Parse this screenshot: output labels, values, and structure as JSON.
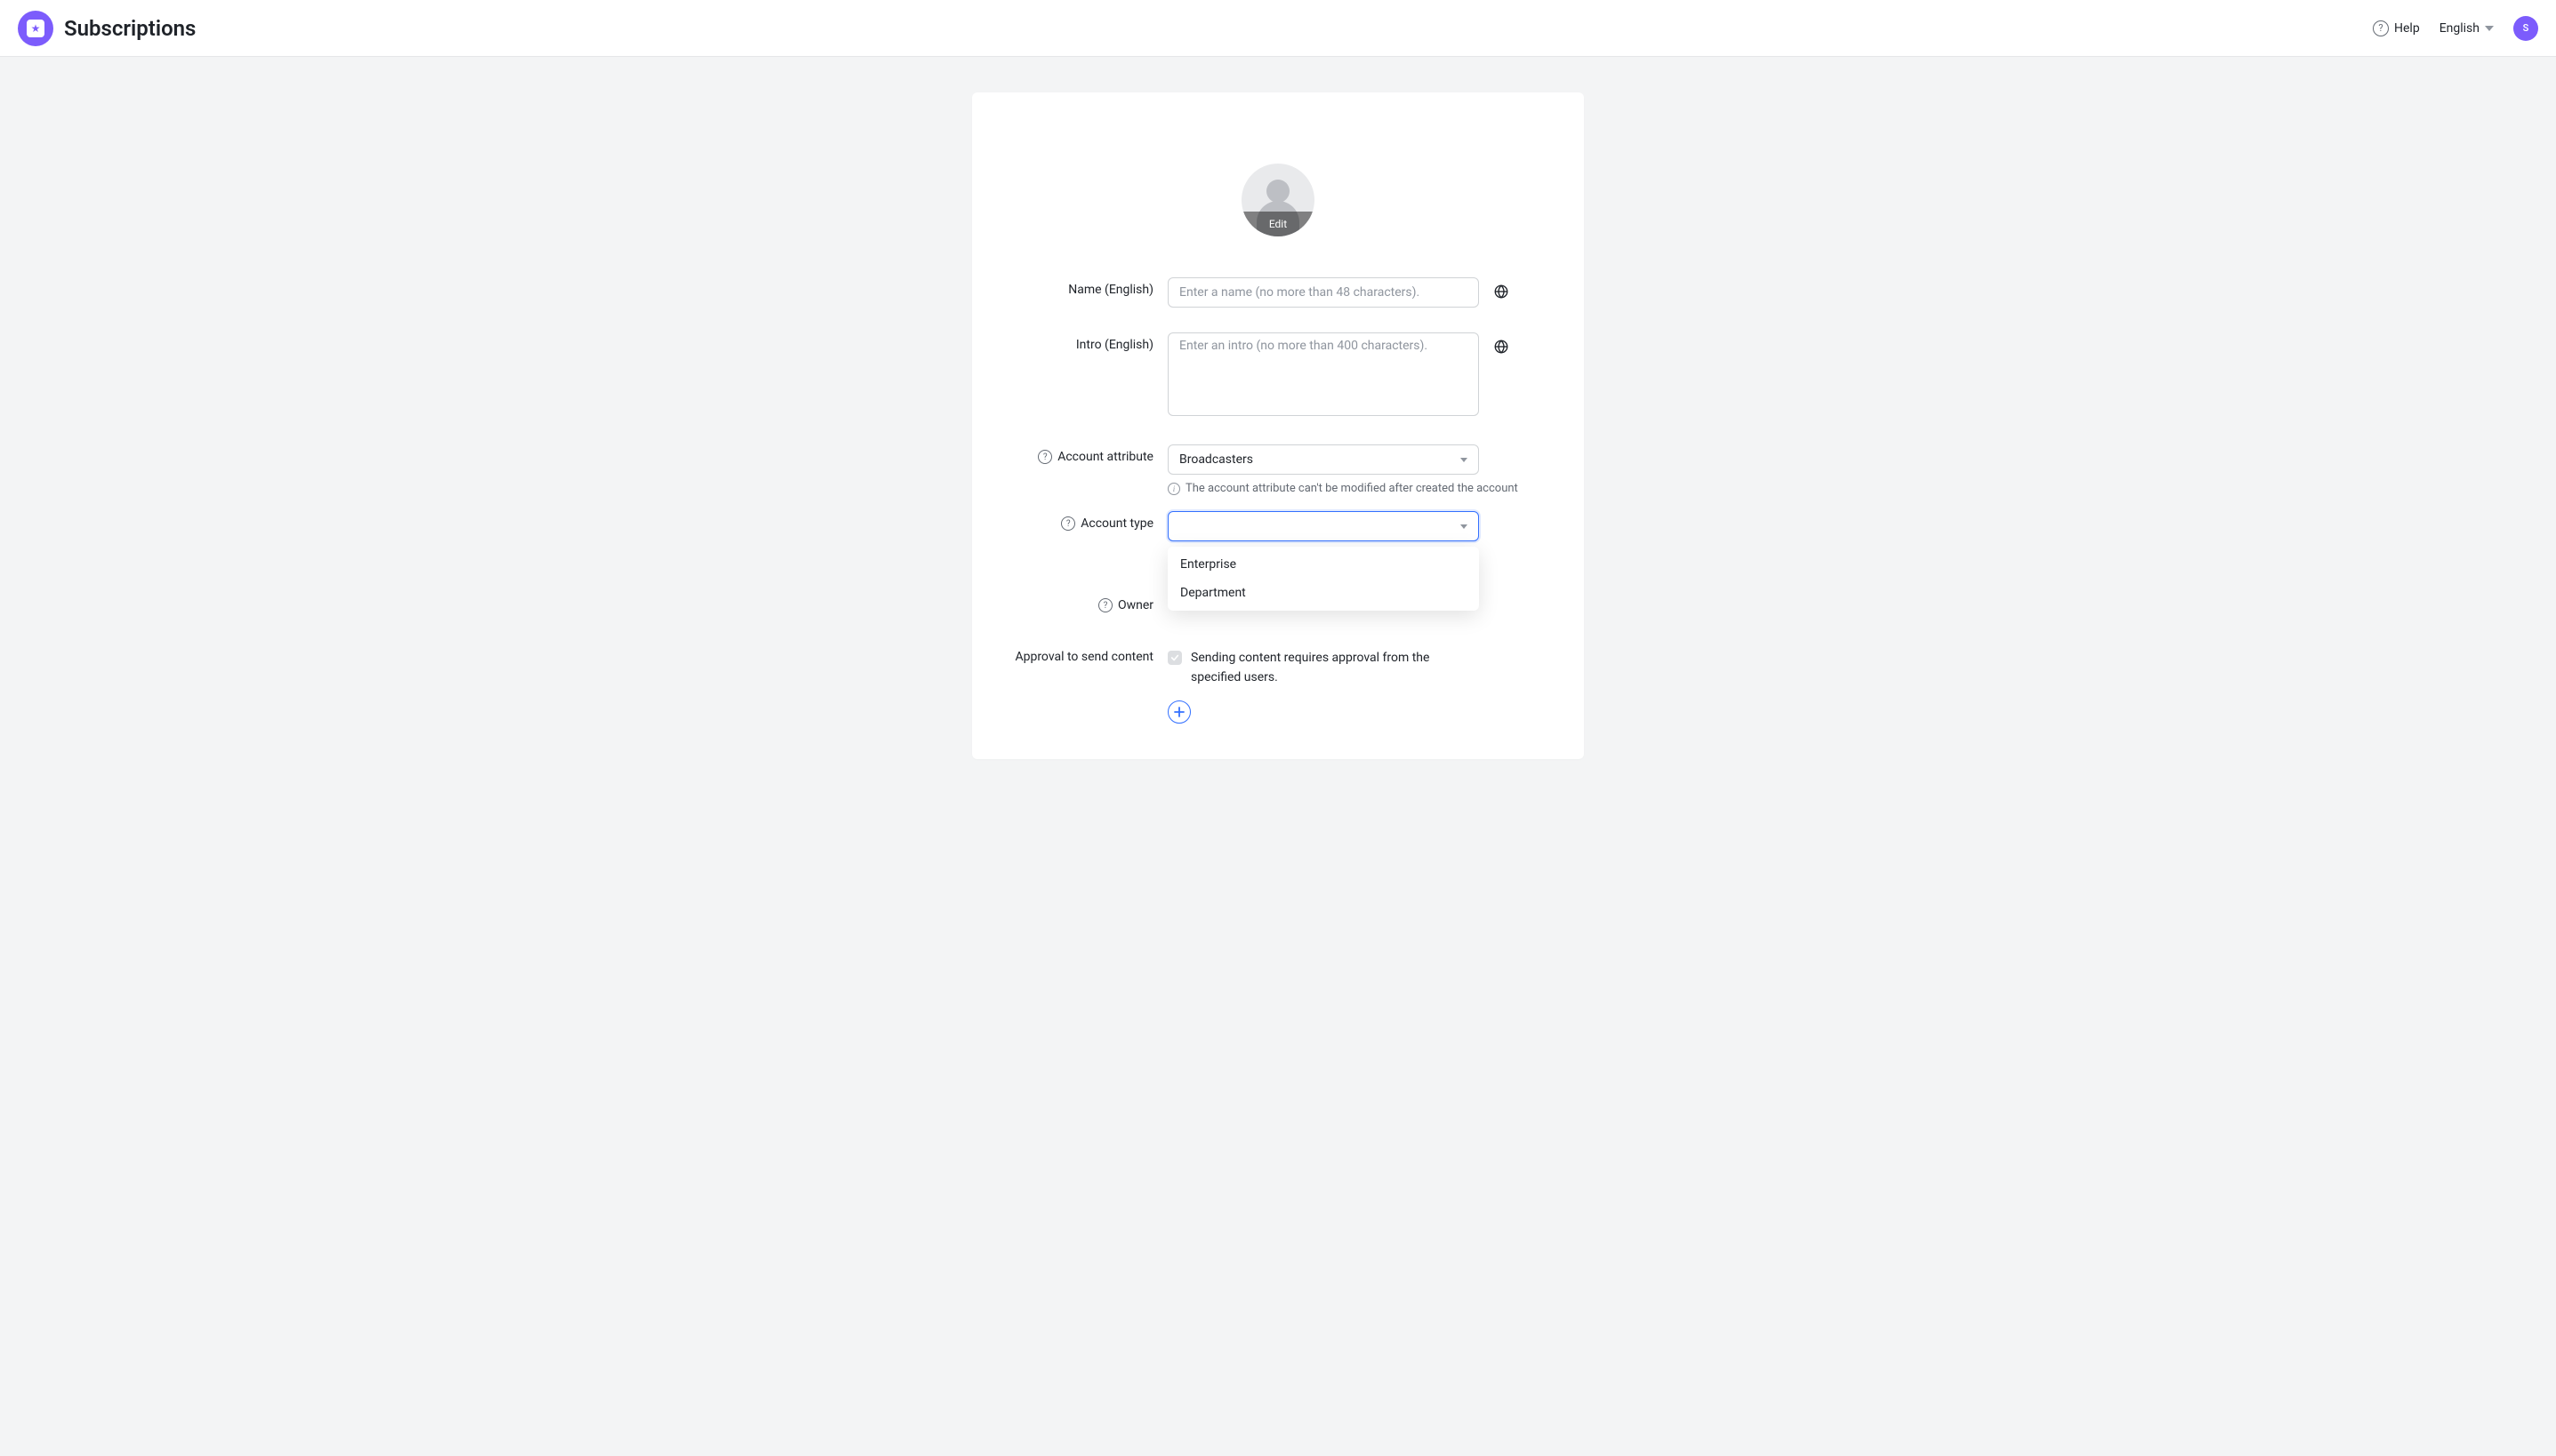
{
  "header": {
    "title": "Subscriptions",
    "help": "Help",
    "language": "English",
    "avatar_initial": "S"
  },
  "avatar": {
    "edit_label": "Edit"
  },
  "form": {
    "name": {
      "label": "Name (English)",
      "placeholder": "Enter a name (no more than 48 characters).",
      "value": ""
    },
    "intro": {
      "label": "Intro (English)",
      "placeholder": "Enter an intro (no more than 400 characters).",
      "value": ""
    },
    "account_attribute": {
      "label": "Account attribute",
      "value": "Broadcasters",
      "hint": "The account attribute can't be modified after created the account"
    },
    "account_type": {
      "label": "Account type",
      "value": "",
      "options": [
        "Enterprise",
        "Department"
      ]
    },
    "owner": {
      "label": "Owner"
    },
    "approval": {
      "label": "Approval to send content",
      "checkbox_label": "Sending content requires approval from the specified users.",
      "checked": true
    }
  }
}
